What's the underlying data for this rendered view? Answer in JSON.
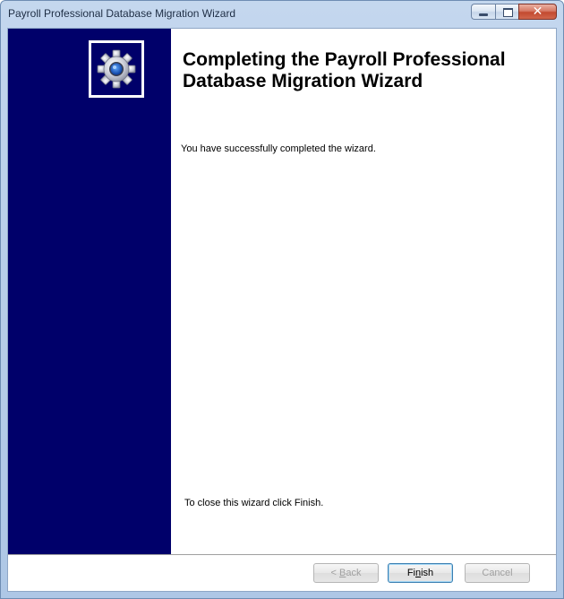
{
  "window": {
    "title": "Payroll Professional Database Migration Wizard",
    "caption_buttons": [
      "minimize-icon",
      "maximize-icon",
      "close-icon"
    ],
    "close_glyph": "✕"
  },
  "sidebar": {
    "logo_icon": "gear-icon",
    "color": "#00006a"
  },
  "main": {
    "heading": "Completing the Payroll Professional Database Migration Wizard",
    "message": "You have successfully completed the wizard.",
    "close_hint": "To close this wizard click Finish."
  },
  "buttons": {
    "back": {
      "pre": "< ",
      "key": "B",
      "post": "ack",
      "enabled": false
    },
    "finish": {
      "pre": "Fi",
      "key": "n",
      "post": "ish",
      "enabled": true
    },
    "cancel": {
      "label": "Cancel",
      "enabled": false
    }
  }
}
